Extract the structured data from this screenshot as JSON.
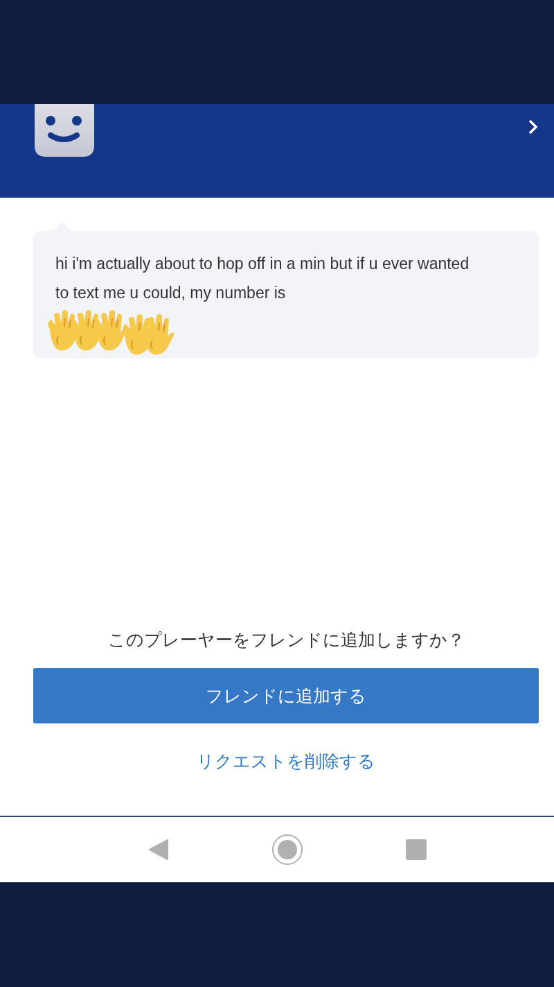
{
  "message": {
    "text": "hi i'm actually about to hop off in a min but if u ever wanted to text me u could, my number is"
  },
  "prompt": "このプレーヤーをフレンドに追加しますか？",
  "add_button": "フレンドに追加する",
  "delete_link": "リクエストを削除する"
}
